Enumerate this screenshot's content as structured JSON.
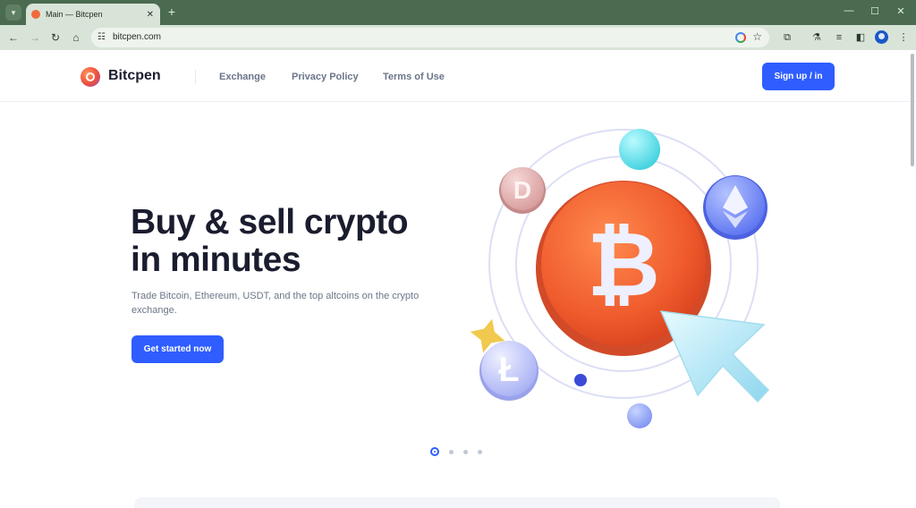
{
  "browser": {
    "tab_title": "Main — Bitcpen",
    "url": "bitcpen.com",
    "tab_menu_icon": "chevron-down-icon",
    "new_tab_glyph": "+",
    "close_glyph": "✕",
    "window_controls": [
      "—",
      "☐",
      "✕"
    ]
  },
  "site": {
    "brand": "Bitcpen",
    "nav": [
      "Exchange",
      "Privacy Policy",
      "Terms of Use"
    ],
    "signup_label": "Sign up / in"
  },
  "hero": {
    "title_line1": "Buy & sell crypto",
    "title_line2": "in minutes",
    "subtitle": "Trade Bitcoin, Ethereum, USDT, and the top altcoins on the crypto exchange.",
    "cta_label": "Get started now"
  },
  "carousel": {
    "count": 4,
    "active_index": 0
  },
  "colors": {
    "accent": "#2f5dff",
    "browser_frame": "#4a6b50",
    "bitcoin_coin": "#ef5a2c"
  }
}
